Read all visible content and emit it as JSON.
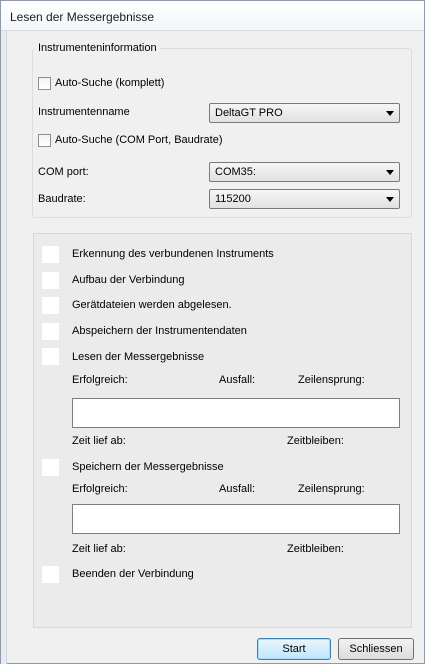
{
  "window": {
    "title": "Lesen der Messergebnisse"
  },
  "instrument_group": {
    "title": "Instrumenteninformation",
    "auto_search_full": "Auto-Suche (komplett)",
    "instrument_name_label": "Instrumentenname",
    "instrument_name_value": "DeltaGT PRO",
    "auto_search_com": "Auto-Suche (COM Port, Baudrate)",
    "com_port_label": "COM port:",
    "com_port_value": "COM35:",
    "baudrate_label": "Baudrate:",
    "baudrate_value": "115200"
  },
  "steps": {
    "detect": "Erkennung des verbundenen Instruments",
    "connect": "Aufbau der Verbindung",
    "read_files": "Gerätdateien werden abgelesen.",
    "save_instrument": "Abspeichern der Instrumentendaten",
    "read_results": "Lesen der Messergebnisse",
    "save_results": "Speichern der Messergebnisse",
    "end_connection": "Beenden der Verbindung"
  },
  "stats": {
    "success": "Erfolgreich:",
    "failure": "Ausfall:",
    "line_skip": "Zeilensprung:",
    "elapsed": "Zeit lief ab:",
    "remaining": "Zeitbleiben:"
  },
  "buttons": {
    "start": "Start",
    "close": "Schliessen"
  }
}
